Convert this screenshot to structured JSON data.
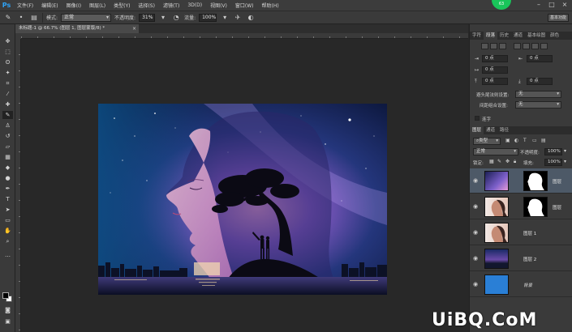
{
  "app": {
    "logo": "Ps"
  },
  "menu": [
    "文件(F)",
    "编辑(E)",
    "图像(I)",
    "图层(L)",
    "类型(Y)",
    "选择(S)",
    "滤镜(T)",
    "3D(D)",
    "视图(V)",
    "窗口(W)",
    "帮助(H)"
  ],
  "badge": "63",
  "options": {
    "mode_label": "模式:",
    "mode_value": "正常",
    "opacity_label": "不透明度:",
    "opacity_value": "31%",
    "flow_label": "流量:",
    "flow_value": "100%",
    "right_button": "基本功能"
  },
  "document": {
    "tab_title": "未标题-1 @ 66.7% (图层 1, 图层蒙版/8) *"
  },
  "paragraph_panel": {
    "tabs": [
      "字符",
      "段落",
      "历史",
      "通道",
      "基本绘图",
      "颜色"
    ],
    "indent_left": "0 点",
    "indent_right": "0 点",
    "indent_first": "0 点",
    "space_before": "0 点",
    "space_after": "0 点",
    "kinsoku_label": "避头尾法则设置:",
    "kinsoku_value": "无",
    "mojikumi_label": "间距组合设置:",
    "mojikumi_value": "无",
    "hyphenate_label": "连字"
  },
  "layers_panel": {
    "tabs": [
      "图层",
      "通道",
      "路径"
    ],
    "filter_value": "类型",
    "blend_value": "正常",
    "opacity_label": "不透明度:",
    "opacity_value": "100%",
    "lock_label": "锁定:",
    "fill_label": "填充:",
    "fill_value": "100%",
    "layers": [
      {
        "name": "图层",
        "active": true,
        "thumb": "galaxy",
        "mask": "head-white"
      },
      {
        "name": "图层",
        "active": false,
        "thumb": "portrait",
        "mask": "head-white"
      },
      {
        "name": "图层 1",
        "active": false,
        "thumb": "portrait",
        "mask": ""
      },
      {
        "name": "图层 2",
        "active": false,
        "thumb": "city",
        "mask": ""
      },
      {
        "name": "背景",
        "active": false,
        "thumb": "blue",
        "mask": ""
      }
    ]
  },
  "watermark": "UiBQ.CoM"
}
